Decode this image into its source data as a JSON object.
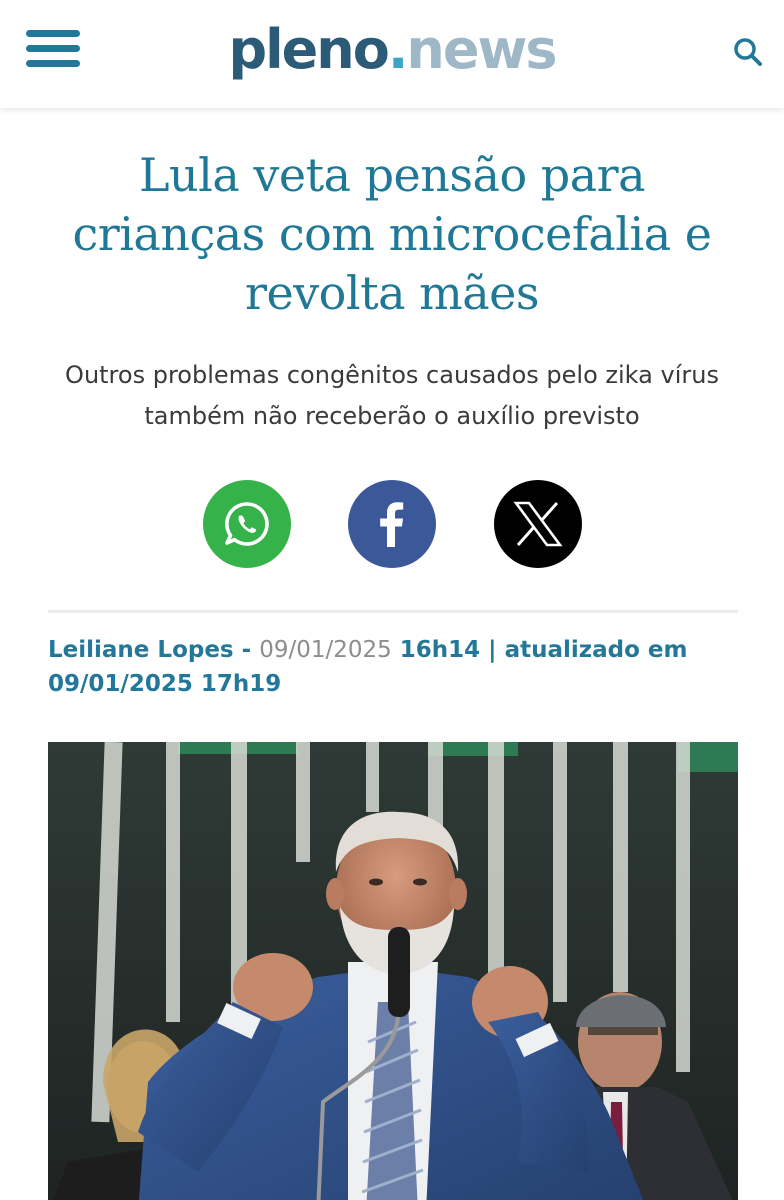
{
  "header": {
    "logo_part1": "pleno",
    "logo_dot": ".",
    "logo_part2": "news"
  },
  "article": {
    "headline": "Lula veta pensão para crianças com microcefalia e revolta mães",
    "subtitle": "Outros problemas congênitos causados pelo zika vírus também não receberão o auxílio previsto",
    "author": "Leiliane Lopes",
    "separator": " - ",
    "date_published": "09/01/2025",
    "time_published": " 16h14 | atualizado em 09/01/2025 17h19"
  },
  "share": {
    "whatsapp_icon": "whatsapp-icon",
    "facebook_icon": "facebook-icon",
    "x_icon": "x-icon"
  },
  "colors": {
    "brand_teal": "#23789a",
    "headline": "#1f7996",
    "whatsapp": "#35b24a",
    "facebook": "#3b5998",
    "x": "#000000"
  }
}
